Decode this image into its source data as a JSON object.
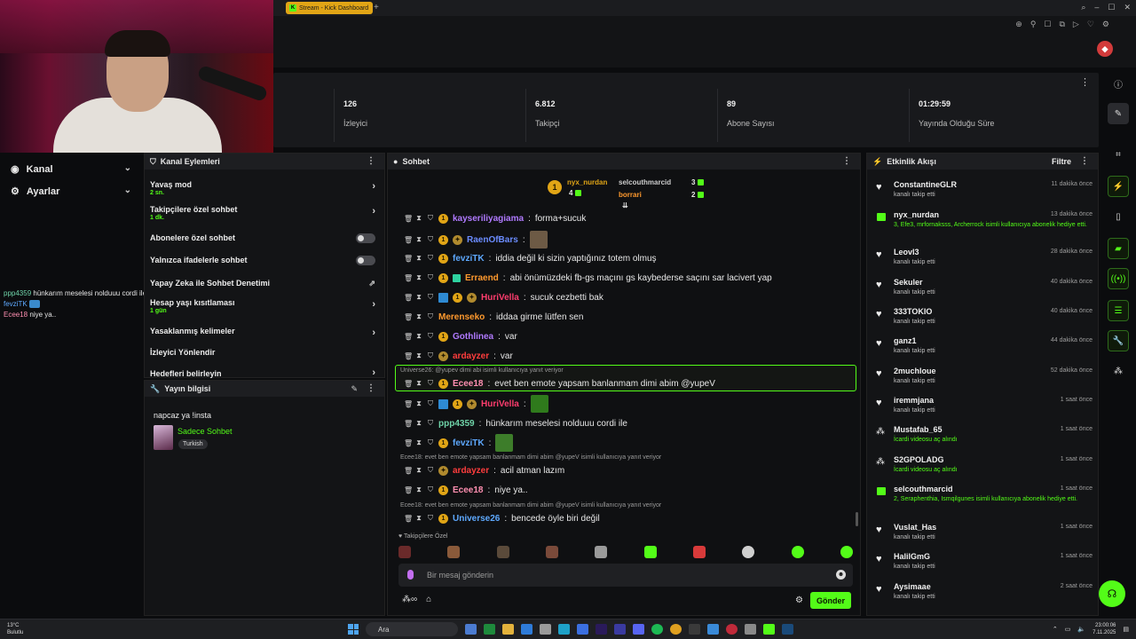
{
  "browser": {
    "tab_title": "Stream - Kick Dashboard",
    "new_tab": "+"
  },
  "stats": [
    {
      "value": "",
      "label": ""
    },
    {
      "value": "126",
      "label": "İzleyici"
    },
    {
      "value": "6.812",
      "label": "Takipçi"
    },
    {
      "value": "89",
      "label": "Abone Sayısı"
    },
    {
      "value": "01:29:59",
      "label": "Yayında Olduğu Süre"
    }
  ],
  "leftnav": {
    "items": [
      {
        "label": "Kanal",
        "icon": "broadcast-icon"
      },
      {
        "label": "Ayarlar",
        "icon": "gear-icon"
      }
    ]
  },
  "overlay_chat": [
    {
      "user": "ppp4359",
      "text": "hünkarım meselesi nolduuu cordi ile"
    },
    {
      "user": "fevziTK",
      "text": ""
    },
    {
      "user": "Ecee18",
      "text": "niye ya.."
    }
  ],
  "actions": {
    "title": "Kanal Eylemleri",
    "rows": [
      {
        "label": "Yavaş mod",
        "sub": "2 sn.",
        "control": "arrow"
      },
      {
        "label": "Takipçilere özel sohbet",
        "sub": "1 dk.",
        "control": "arrow"
      },
      {
        "label": "Abonelere özel sohbet",
        "sub": "",
        "control": "toggle"
      },
      {
        "label": "Yalnızca ifadelerle sohbet",
        "sub": "",
        "control": "toggle"
      },
      {
        "label": "Yapay Zeka ile Sohbet Denetimi",
        "sub": "",
        "control": "external"
      },
      {
        "label": "Hesap yaşı kısıtlaması",
        "sub": "1 gün",
        "control": "arrow"
      },
      {
        "label": "Yasaklanmış kelimeler",
        "sub": "",
        "control": "arrow"
      },
      {
        "label": "İzleyici Yönlendir",
        "sub": "",
        "control": "none"
      },
      {
        "label": "Hedefleri belirleyin",
        "sub": "",
        "control": "arrow"
      }
    ]
  },
  "info": {
    "title": "Yayın bilgisi",
    "stream_title": "napcaz ya !insta",
    "category": "Sadece Sohbet",
    "tag": "Turkish"
  },
  "chat": {
    "title": "Sohbet",
    "leaders": [
      {
        "name": "nyx_nurdan",
        "count": "4"
      },
      {
        "name": "selcouthmarcid",
        "count": "3"
      },
      {
        "name": "borrari",
        "count": "2"
      }
    ],
    "messages": [
      {
        "user": "kayseriliyagiama",
        "text": "forma+sucuk",
        "color": "#b07aff"
      },
      {
        "user": "RaenOfBars",
        "text": "",
        "color": "#6b8cff"
      },
      {
        "user": "fevziTK",
        "text": "iddia değil ki sizin yaptığınız totem olmuş",
        "color": "#5ea9ff"
      },
      {
        "user": "Erraend",
        "text": "abi önümüzdeki fb-gs maçını gs kaybederse saçını sar lacivert yap",
        "color": "#ff9a2e"
      },
      {
        "user": "HuriVella",
        "text": "sucuk cezbetti bak",
        "color": "#ff3d6e"
      },
      {
        "user": "Merenseko",
        "text": "iddaa girme lütfen sen",
        "color": "#ff9a2e"
      },
      {
        "user": "Gothlinea",
        "text": "var",
        "color": "#b07aff"
      },
      {
        "user": "ardayzer",
        "text": "var",
        "color": "#ff3d3d"
      },
      {
        "user": "Ecee18",
        "text": "evet ben emote yapsam banlanmam dimi abim @yupeV",
        "color": "#ff8fb1"
      },
      {
        "user": "HuriVella",
        "text": "",
        "color": "#ff3d6e"
      },
      {
        "user": "ppp4359",
        "text": "hünkarım meselesi nolduuu cordi ile",
        "color": "#6fd3a8"
      },
      {
        "user": "fevziTK",
        "text": "",
        "color": "#5ea9ff"
      },
      {
        "user": "ardayzer",
        "text": "acil atman lazım",
        "color": "#ff3d3d"
      },
      {
        "user": "Ecee18",
        "text": "niye ya..",
        "color": "#ff8fb1"
      },
      {
        "user": "Universe26",
        "text": "bencede öyle biri değil",
        "color": "#5ea9ff"
      }
    ],
    "reply_hints": [
      "Universe26: @yupev dimi abi isimli kullanıcıya yanıt veriyor",
      "Ecee18: evet ben emote yapsam banlanmam dimi abim @yupeV isimli kullanıcıya yanıt veriyor",
      "Ecee18: evet ben emote yapsam banlanmam dimi abim @yupeV isimli kullanıcıya yanıt veriyor"
    ],
    "followers_only": "Takipçilere Özel",
    "input_placeholder": "Bir mesaj gönderin",
    "send_label": "Gönder"
  },
  "feed": {
    "title": "Etkinlik Akışı",
    "filter": "Filtre",
    "events": [
      {
        "type": "follow",
        "user": "ConstantineGLR",
        "text": "kanalı takip etti",
        "time": "11 dakika önce"
      },
      {
        "type": "gift",
        "user": "nyx_nurdan",
        "text": "3, Efe3, mrfornaksss, Archerrock isimli kullanıcıya abonelik hediye etti.",
        "time": "13 dakika önce"
      },
      {
        "type": "follow",
        "user": "LeovI3",
        "text": "kanalı takip etti",
        "time": "28 dakika önce"
      },
      {
        "type": "follow",
        "user": "Sekuler",
        "text": "kanalı takip etti",
        "time": "40 dakika önce"
      },
      {
        "type": "follow",
        "user": "333TOKIO",
        "text": "kanalı takip etti",
        "time": "40 dakika önce"
      },
      {
        "type": "follow",
        "user": "ganz1",
        "text": "kanalı takip etti",
        "time": "44 dakika önce"
      },
      {
        "type": "follow",
        "user": "2muchloue",
        "text": "kanalı takip etti",
        "time": "52 dakika önce"
      },
      {
        "type": "follow",
        "user": "iremmjana",
        "text": "kanalı takip etti",
        "time": "1 saat önce"
      },
      {
        "type": "reward",
        "user": "Mustafab_65",
        "text": "İcardi videosu aç alındı",
        "time": "1 saat önce"
      },
      {
        "type": "reward",
        "user": "S2GPOLADG",
        "text": "İcardi videosu aç alındı",
        "time": "1 saat önce"
      },
      {
        "type": "gift",
        "user": "selcouthmarcid",
        "text": "2, Seraphenthia, Ismqilgunes isimli kullanıcıya abonelik hediye etti.",
        "time": "1 saat önce"
      },
      {
        "type": "follow",
        "user": "Vuslat_Has",
        "text": "kanalı takip etti",
        "time": "1 saat önce"
      },
      {
        "type": "follow",
        "user": "HalilGmG",
        "text": "kanalı takip etti",
        "time": "1 saat önce"
      },
      {
        "type": "follow",
        "user": "Aysimaae",
        "text": "kanalı takip etti",
        "time": "2 saat önce"
      }
    ]
  },
  "taskbar": {
    "weather_temp": "13°C",
    "weather_desc": "Bulutlu",
    "search": "Ara",
    "time": "23:00:06",
    "date": "7.11.2025"
  },
  "colors": {
    "accent": "#53fc18",
    "badge": "#e1a516"
  }
}
